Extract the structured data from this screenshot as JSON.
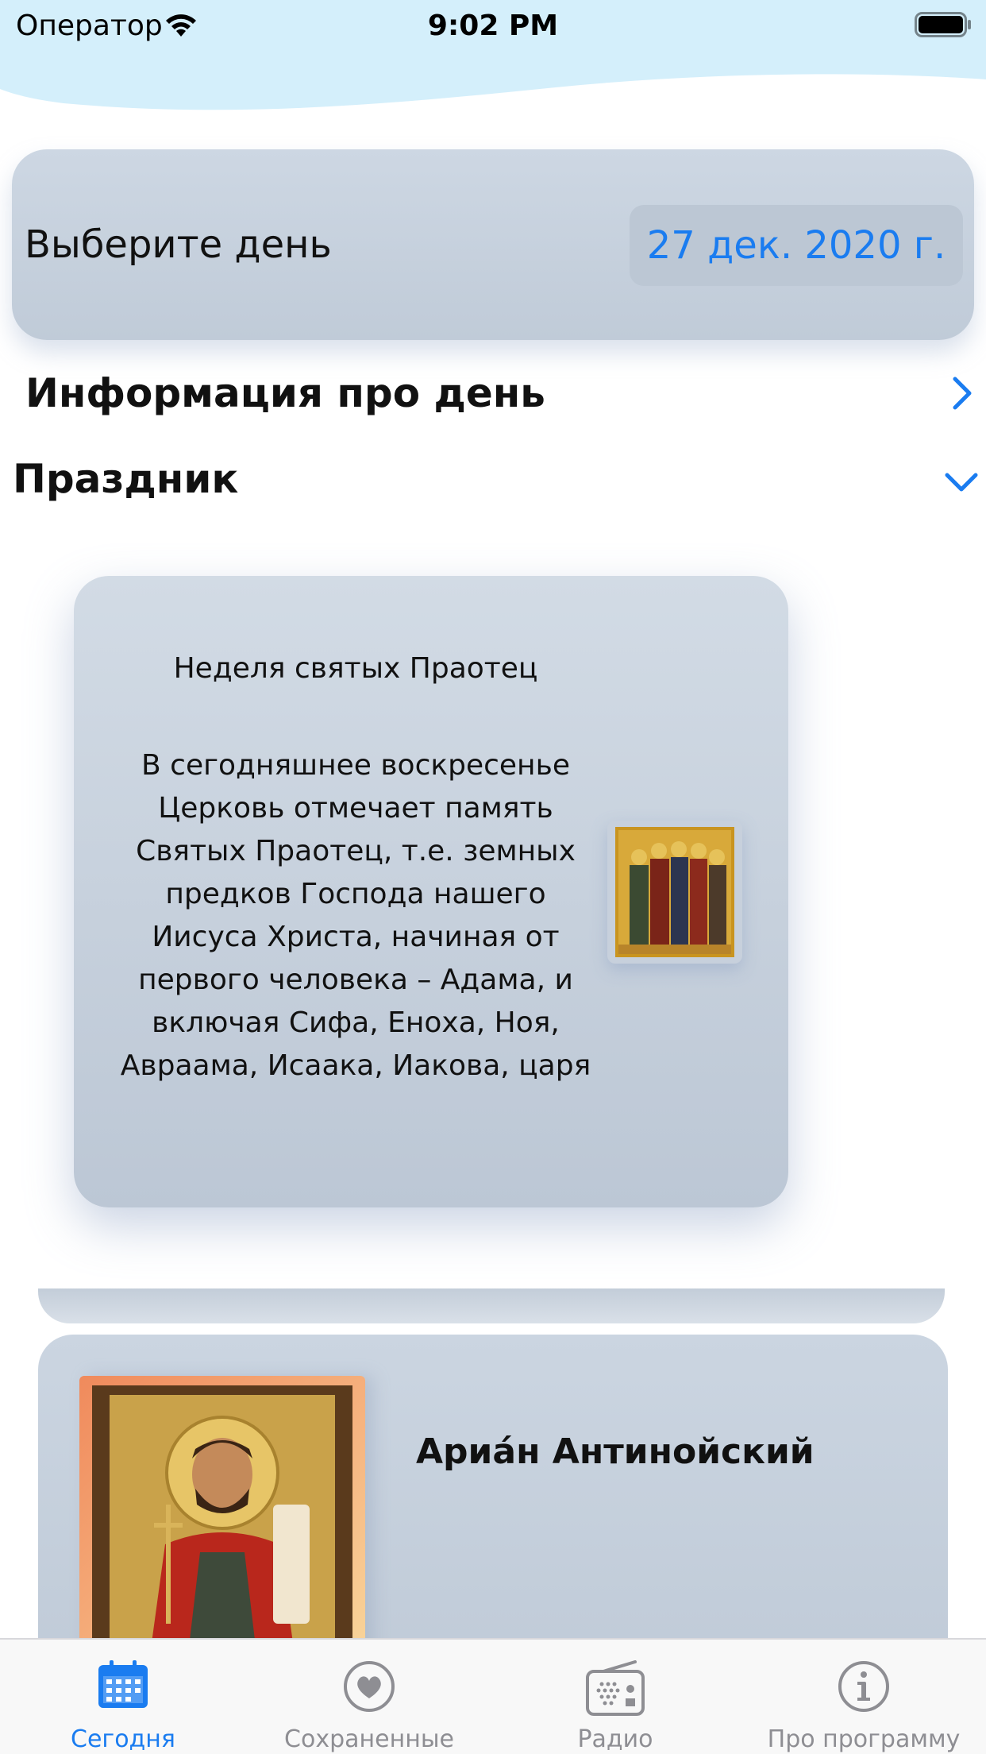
{
  "status_bar": {
    "carrier": "Оператор",
    "time": "9:02 PM"
  },
  "date_picker": {
    "label": "Выберите день",
    "value": "27 дек. 2020 г."
  },
  "info_section": {
    "title": "Информация про день"
  },
  "holiday_section": {
    "title": "Праздник",
    "card": {
      "name": "Неделя святых Праотец",
      "description": "В сегодняшнее воскресенье Церковь отмечает память Святых Праотец, т.е. земных предков Господа нашего Иисуса Христа, начиная от первого человека – Адама, и включая Сифа, Еноха, Ноя, Авраама, Исаака, Иакова, царя"
    }
  },
  "saint_card": {
    "name": "Ариа́н Антинойский"
  },
  "tabs": [
    {
      "label": "Сегодня",
      "icon": "calendar-icon",
      "active": true
    },
    {
      "label": "Сохраненные",
      "icon": "heart-icon",
      "active": false
    },
    {
      "label": "Радио",
      "icon": "radio-icon",
      "active": false
    },
    {
      "label": "Про программу",
      "icon": "info-icon",
      "active": false
    }
  ],
  "colors": {
    "accent": "#1a7cf0",
    "card": "#c6d0dc",
    "inactive_tab": "#8e8e93",
    "wave": "#d4effb"
  }
}
